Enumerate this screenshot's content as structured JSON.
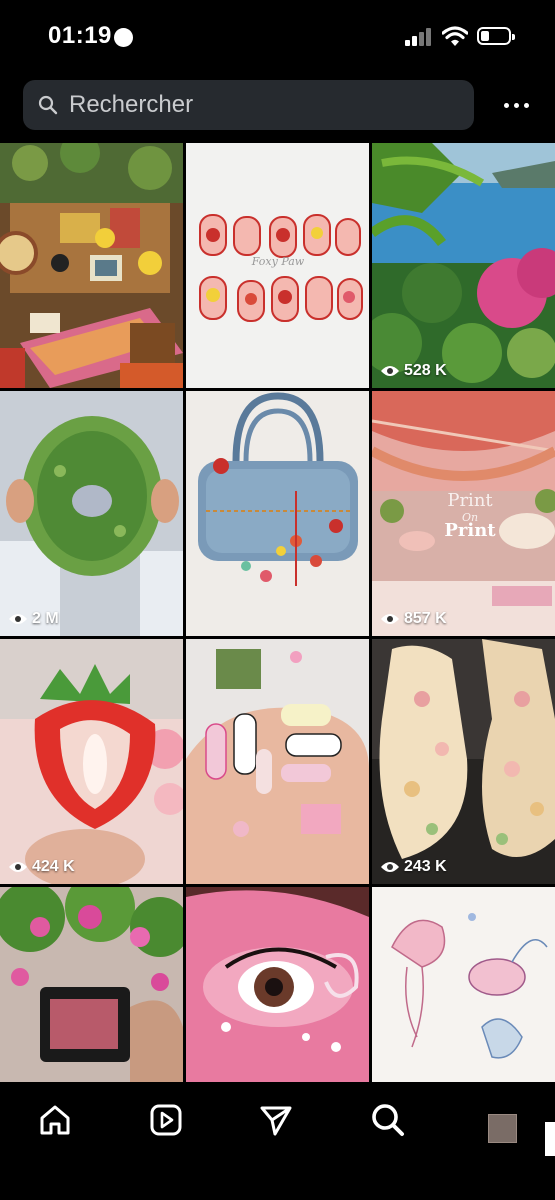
{
  "status_bar": {
    "time": "01:19"
  },
  "search": {
    "placeholder": "Rechercher",
    "value": ""
  },
  "grid": {
    "tiles": [
      {
        "id": "cluttered-room",
        "views": ""
      },
      {
        "id": "press-on-nails",
        "views": ""
      },
      {
        "id": "lake-garden",
        "views": "528 K"
      },
      {
        "id": "green-bowl",
        "views": "2 M"
      },
      {
        "id": "denim-bag",
        "views": ""
      },
      {
        "id": "pink-venue",
        "views": "857 K"
      },
      {
        "id": "beaded-strawberry",
        "views": "424 K"
      },
      {
        "id": "nail-art",
        "views": ""
      },
      {
        "id": "floral-dress",
        "views": "243 K"
      },
      {
        "id": "flower-street-camera",
        "views": ""
      },
      {
        "id": "pink-eye-makeup",
        "views": ""
      },
      {
        "id": "fairy-sketches",
        "views": ""
      }
    ],
    "watermarks": {
      "nails": "Foxy Paw",
      "print_top": "Print",
      "print_mid": "On",
      "print_bottom": "Print"
    }
  },
  "nav": {
    "items": [
      "home-icon",
      "reels-icon",
      "send-icon",
      "search-icon",
      "profile-avatar"
    ]
  },
  "colors": {
    "background": "#000000",
    "search_bg": "#262a2f"
  }
}
